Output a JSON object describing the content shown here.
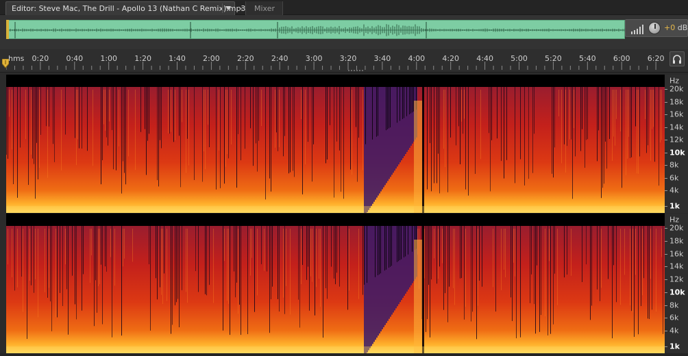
{
  "tabs": {
    "editor_label": "Editor: Steve Mac, The Drill - Apollo 13 (Nathan C Remix).mp3",
    "close_glyph": "×",
    "mixer_label": "Mixer"
  },
  "hud": {
    "gain_value": "+0",
    "gain_unit": " dB"
  },
  "ruler": {
    "unit_label": "hms",
    "ticks": [
      "0:20",
      "0:40",
      "1:00",
      "1:20",
      "1:40",
      "2:00",
      "2:20",
      "2:40",
      "3:00",
      "3:20",
      "3:40",
      "4:00",
      "4:20",
      "4:40",
      "5:00",
      "5:20",
      "5:40",
      "6:00",
      "6:20"
    ]
  },
  "freq_scale": {
    "unit": "Hz",
    "labels": [
      "20k",
      "18k",
      "16k",
      "14k",
      "12k",
      "10k",
      "8k",
      "6k",
      "4k",
      "1k"
    ],
    "bold_labels": [
      "10k",
      "1k"
    ]
  },
  "colors": {
    "overview_waveform": "#7dcda3",
    "accent_gain": "#e6b84a",
    "spectrum_low": "#ffdc64",
    "spectrum_mid": "#dc3913",
    "spectrum_high": "#9a1d2e",
    "spectrum_quiet": "#3a1a6a"
  },
  "icons": {
    "tab_dropdown": "chevron-down-icon",
    "tab_close": "close-icon",
    "playhead": "playhead-marker-icon",
    "monitor": "headphones-icon",
    "level_meter": "level-meter-icon",
    "volume_knob": "volume-knob-icon"
  }
}
